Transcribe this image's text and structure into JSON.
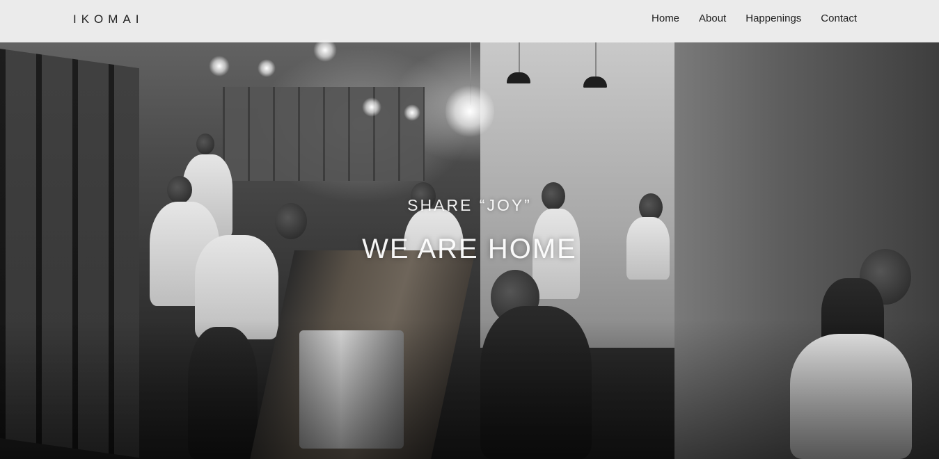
{
  "header": {
    "logo": "IKOMAI",
    "nav": [
      {
        "label": "Home"
      },
      {
        "label": "About"
      },
      {
        "label": "Happenings"
      },
      {
        "label": "Contact"
      }
    ]
  },
  "hero": {
    "tagline": "SHARE “JOY”",
    "headline": "WE ARE HOME",
    "image_style": "grayscale restaurant interior photo"
  },
  "colors": {
    "topbar_bg": "#f5f5f5",
    "nav_text": "#1e1e1e",
    "hero_text": "#ffffff"
  }
}
